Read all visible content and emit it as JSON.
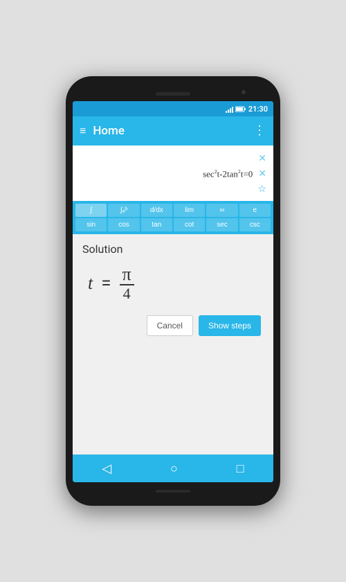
{
  "status_bar": {
    "time": "21:30"
  },
  "app_bar": {
    "title": "Home",
    "hamburger": "≡",
    "more": "⋮"
  },
  "equations": [
    {
      "text": "",
      "has_x": true,
      "has_star": false
    },
    {
      "text": "sec²t-2tan²t=0",
      "has_x": true,
      "has_star": false
    },
    {
      "text": "",
      "has_x": false,
      "has_star": true
    }
  ],
  "keyboard": {
    "row1": [
      "∫",
      "∫ₐᵇ",
      "d/dx",
      "lim",
      "∞",
      "e"
    ],
    "row2": [
      "sin",
      "cos",
      "tan",
      "cot",
      "sec",
      "csc"
    ]
  },
  "solution": {
    "label": "Solution",
    "variable": "t",
    "equals": "=",
    "numerator": "π",
    "denominator": "4"
  },
  "buttons": {
    "cancel": "Cancel",
    "show_steps": "Show steps"
  },
  "bottom_nav": {
    "back": "◁",
    "home": "○",
    "recent": "□"
  },
  "colors": {
    "primary": "#29b6e8",
    "accent": "#1a9bd5",
    "text_dark": "#333333",
    "bg_light": "#f0f0f0"
  }
}
